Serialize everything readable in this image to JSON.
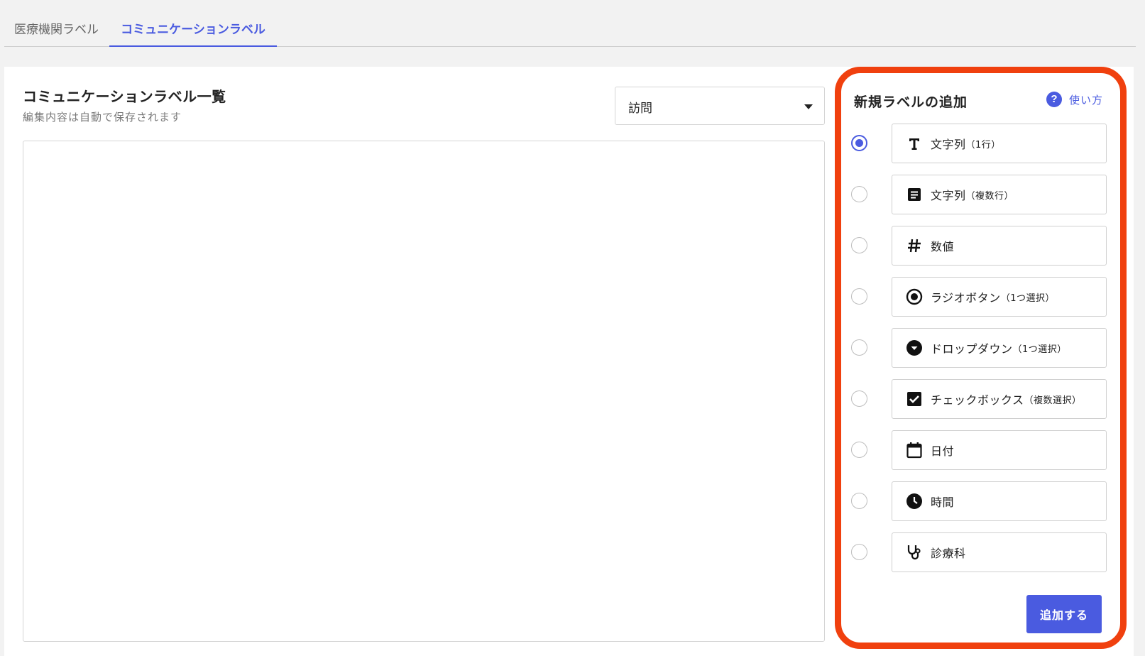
{
  "tabs": [
    {
      "label": "医療機関ラベル"
    },
    {
      "label": "コミュニケーションラベル"
    }
  ],
  "list": {
    "title": "コミュニケーションラベル一覧",
    "subtitle": "編集内容は自動で保存されます",
    "dropdown_value": "訪問"
  },
  "add_panel": {
    "title": "新規ラベルの追加",
    "help_label": "使い方",
    "button_label": "追加する",
    "options": [
      {
        "label": "文字列",
        "note": "（1行）",
        "icon": "text-t-icon",
        "selected": true
      },
      {
        "label": "文字列",
        "note": "（複数行）",
        "icon": "notes-icon",
        "selected": false
      },
      {
        "label": "数値",
        "note": "",
        "icon": "hash-icon",
        "selected": false
      },
      {
        "label": "ラジオボタン",
        "note": "（1つ選択）",
        "icon": "radio-icon",
        "selected": false
      },
      {
        "label": "ドロップダウン",
        "note": "（1つ選択）",
        "icon": "dropdown-icon",
        "selected": false
      },
      {
        "label": "チェックボックス",
        "note": "（複数選択）",
        "icon": "checkbox-icon",
        "selected": false
      },
      {
        "label": "日付",
        "note": "",
        "icon": "calendar-icon",
        "selected": false
      },
      {
        "label": "時間",
        "note": "",
        "icon": "clock-icon",
        "selected": false
      },
      {
        "label": "診療科",
        "note": "",
        "icon": "stethoscope-icon",
        "selected": false
      }
    ]
  },
  "colors": {
    "accent": "#4a5be0",
    "highlight_border": "#f0400e"
  }
}
